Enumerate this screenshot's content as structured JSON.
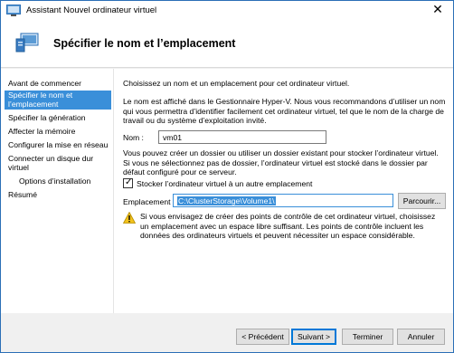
{
  "window": {
    "title": "Assistant Nouvel ordinateur virtuel",
    "close_glyph": "✕"
  },
  "header": {
    "title": "Spécifier le nom et l’emplacement",
    "icon": "virtual-machine-icon"
  },
  "sidebar": {
    "items": [
      {
        "label": "Avant de commencer",
        "active": false
      },
      {
        "label": "Spécifier le nom et l’emplacement",
        "active": true
      },
      {
        "label": "Spécifier la génération",
        "active": false
      },
      {
        "label": "Affecter la mémoire",
        "active": false
      },
      {
        "label": "Configurer la mise en réseau",
        "active": false
      },
      {
        "label": "Connecter un disque dur virtuel",
        "active": false
      },
      {
        "label": "Options d’installation",
        "active": false
      },
      {
        "label": "Résumé",
        "active": false
      }
    ]
  },
  "content": {
    "intro": "Choisissez un nom et un emplacement pour cet ordinateur virtuel.",
    "name_help": "Le nom est affiché dans le Gestionnaire Hyper-V. Nous vous recommandons d’utiliser un nom qui vous permettra d’identifier facilement cet ordinateur virtuel, tel que le nom de la charge de travail ou du système d’exploitation invité.",
    "name_label": "Nom :",
    "name_value": "vm01",
    "folder_help": "Vous pouvez créer un dossier ou utiliser un dossier existant pour stocker l’ordinateur virtuel. Si vous ne sélectionnez pas de dossier, l’ordinateur virtuel est stocké dans le dossier par défaut configuré pour ce serveur.",
    "store_checkbox_label": "Stocker l’ordinateur virtuel à un autre emplacement",
    "store_checked": true,
    "location_label": "Emplacement :",
    "location_value": "C:\\ClusterStorage\\Volume1\\",
    "browse_label": "Parcourir...",
    "warning_text": "Si vous envisagez de créer des points de contrôle de cet ordinateur virtuel, choisissez un emplacement avec un espace libre suffisant. Les points de contrôle incluent les données des ordinateurs virtuels et peuvent nécessiter un espace considérable."
  },
  "footer": {
    "previous_label": "< Précédent",
    "next_label": "Suivant >",
    "finish_label": "Terminer",
    "cancel_label": "Annuler"
  },
  "colors": {
    "accent": "#3a8fd9",
    "window_border": "#2b6fb6",
    "warning": "#f2c21b"
  }
}
